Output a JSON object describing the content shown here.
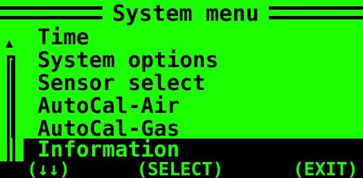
{
  "header": {
    "title": "System menu"
  },
  "menu": {
    "items": [
      {
        "label": "Time"
      },
      {
        "label": "System options"
      },
      {
        "label": "Sensor select"
      },
      {
        "label": "AutoCal-Air"
      },
      {
        "label": "AutoCal-Gas"
      },
      {
        "label": "Information"
      }
    ],
    "selected_index": 5
  },
  "footer": {
    "left": "(↓↓)",
    "center": "(SELECT)",
    "right": "(EXIT)"
  },
  "colors": {
    "background": "#1cff00",
    "foreground": "#000000"
  }
}
